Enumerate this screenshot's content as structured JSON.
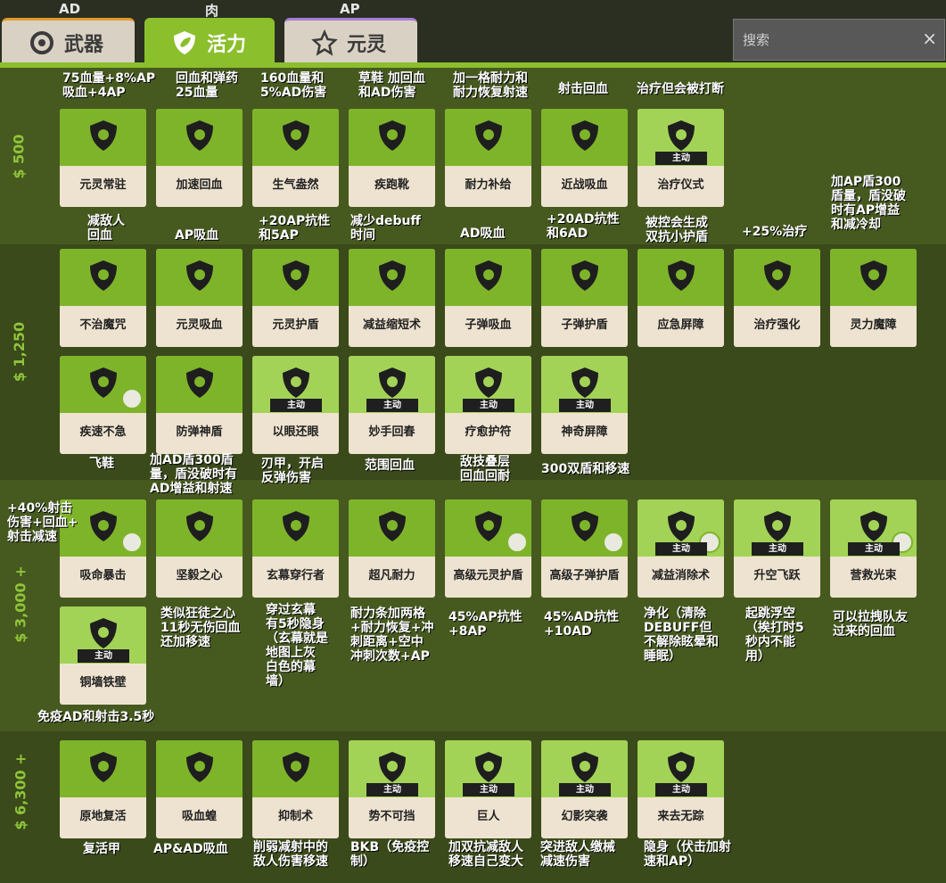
{
  "header_labels": [
    "AD",
    "肉",
    "AP"
  ],
  "tabs": [
    {
      "label": "武器",
      "active": false,
      "icon": "target-icon"
    },
    {
      "label": "活力",
      "active": true,
      "icon": "shield-leaf-icon"
    },
    {
      "label": "元灵",
      "active": false,
      "icon": "star-icon"
    }
  ],
  "search": {
    "placeholder": "搜索",
    "clear": "×"
  },
  "tiers": [
    {
      "price": "$ 500"
    },
    {
      "price": "$ 1,250"
    },
    {
      "price": "$ 3,000 +"
    },
    {
      "price": "$ 6,300 +"
    }
  ],
  "items": [
    {
      "name": "元灵常驻",
      "badge": ""
    },
    {
      "name": "加速回血",
      "badge": ""
    },
    {
      "name": "生气盎然",
      "badge": ""
    },
    {
      "name": "疾跑靴",
      "badge": ""
    },
    {
      "name": "耐力补给",
      "badge": ""
    },
    {
      "name": "近战吸血",
      "badge": ""
    },
    {
      "name": "治疗仪式",
      "badge": "主动"
    },
    {
      "name": "不治魔咒",
      "badge": ""
    },
    {
      "name": "元灵吸血",
      "badge": ""
    },
    {
      "name": "元灵护盾",
      "badge": ""
    },
    {
      "name": "减益缩短术",
      "badge": ""
    },
    {
      "name": "子弹吸血",
      "badge": ""
    },
    {
      "name": "子弹护盾",
      "badge": ""
    },
    {
      "name": "应急屏障",
      "badge": ""
    },
    {
      "name": "治疗强化",
      "badge": ""
    },
    {
      "name": "灵力魔障",
      "badge": ""
    },
    {
      "name": "疾速不急",
      "badge": ""
    },
    {
      "name": "防弹神盾",
      "badge": ""
    },
    {
      "name": "以眼还眼",
      "badge": "主动"
    },
    {
      "name": "妙手回春",
      "badge": "主动"
    },
    {
      "name": "疗愈护符",
      "badge": "主动"
    },
    {
      "name": "神奇屏障",
      "badge": "主动"
    },
    {
      "name": "吸命暴击",
      "badge": ""
    },
    {
      "name": "坚毅之心",
      "badge": ""
    },
    {
      "name": "玄幕穿行者",
      "badge": ""
    },
    {
      "name": "超凡耐力",
      "badge": ""
    },
    {
      "name": "高级元灵护盾",
      "badge": ""
    },
    {
      "name": "高级子弹护盾",
      "badge": ""
    },
    {
      "name": "减益消除术",
      "badge": "主动"
    },
    {
      "name": "升空飞跃",
      "badge": "主动"
    },
    {
      "name": "营救光束",
      "badge": "主动"
    },
    {
      "name": "铜墙铁壁",
      "badge": "主动"
    },
    {
      "name": "原地复活",
      "badge": ""
    },
    {
      "name": "吸血蝗",
      "badge": ""
    },
    {
      "name": "抑制术",
      "badge": ""
    },
    {
      "name": "势不可挡",
      "badge": "主动"
    },
    {
      "name": "巨人",
      "badge": "主动"
    },
    {
      "name": "幻影突袭",
      "badge": "主动"
    },
    {
      "name": "来去无踪",
      "badge": "主动"
    }
  ],
  "notes": [
    "75血量+8%AP\n吸血+4AP",
    "回血和弹药\n25血量",
    "160血量和\n5%AD伤害",
    "草鞋 加回血\n和AD伤害",
    "加一格耐力和\n耐力恢复射速",
    "射击回血",
    "治疗但会被打断",
    "减敌人\n回血",
    "AP吸血",
    "+20AP抗性\n和5AP",
    "减少debuff\n时间",
    "AD吸血",
    "+20AD抗性\n和6AD",
    "被控会生成\n双抗小护盾",
    "+25%治疗",
    "加AP盾300\n盾量，盾没破\n时有AP增益\n和减冷却",
    "飞鞋",
    "加AD盾300盾\n量，盾没破时有\nAD增益和射速",
    "刃甲，开启\n反弹伤害",
    "范围回血",
    "敌技叠层\n回血回耐",
    "300双盾和移速",
    "+40%射击\n伤害+回血+\n射击减速",
    "类似狂徒之心\n11秒无伤回血\n还加移速",
    "穿过玄幕\n有5秒隐身\n（玄幕就是\n地图上灰\n白色的幕\n墙）",
    "耐力条加两格\n+耐力恢复+冲\n刺距离+空中\n冲刺次数+AP",
    "45%AP抗性\n+8AP",
    "45%AD抗性\n+10AD",
    "净化（清除\nDEBUFF但\n不解除眩晕和\n睡眠）",
    "起跳浮空\n（挨打时5\n秒内不能\n用）",
    "可以拉拽队友\n过来的回血",
    "免疫AD和射击3.5秒",
    "复活甲",
    "AP&AD吸血",
    "削弱减射中的\n敌人伤害移速",
    "BKB（免疫控\n制）",
    "加双抗减敌人\n移速自己变大",
    "突进敌人缴械\n减速伤害",
    "隐身（伏击加射\n速和AP）"
  ]
}
